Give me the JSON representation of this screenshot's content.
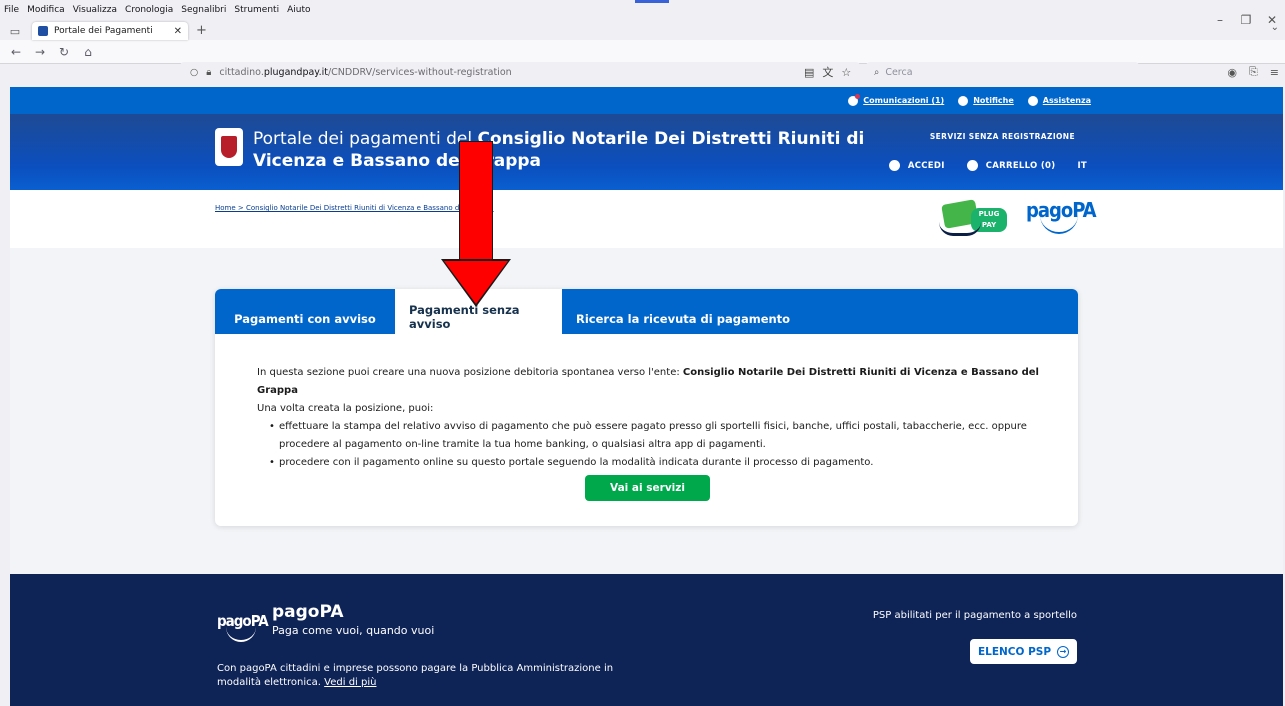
{
  "browser": {
    "menu": [
      "File",
      "Modifica",
      "Visualizza",
      "Cronologia",
      "Segnalibri",
      "Strumenti",
      "Aiuto"
    ],
    "tab_title": "Portale dei Pagamenti",
    "url_prefix": "cittadino.",
    "url_domain": "plugandpay.it",
    "url_path": "/CNDDRV/services-without-registration",
    "search_placeholder": "Cerca"
  },
  "topstrip": {
    "communications": "Comunicazioni (1)",
    "notifications": "Notifiche",
    "support": "Assistenza"
  },
  "header": {
    "title_prefix": "Portale dei pagamenti del ",
    "title_entity": "Consiglio Notarile Dei Distretti Riuniti di Vicenza e Bassano del Grappa",
    "services_label": "SERVIZI SENZA REGISTRAZIONE",
    "login": "ACCEDI",
    "cart": "CARRELLO (0)",
    "lang": "IT"
  },
  "breadcrumb": "Home > Consiglio Notarile Dei Distretti Riuniti di Vicenza e Bassano del Grappa",
  "brand": {
    "plug_text": "PLUG PAY",
    "pagopa_text": "pagoPA"
  },
  "tabs": {
    "with_notice": "Pagamenti con avviso",
    "without_notice": "Pagamenti senza avviso",
    "receipt": "Ricerca la ricevuta di pagamento"
  },
  "content": {
    "intro_prefix": "In questa sezione puoi creare una nuova posizione debitoria spontanea verso l'ente: ",
    "intro_entity": "Consiglio Notarile Dei Distretti Riuniti di Vicenza e Bassano del Grappa",
    "then": "Una volta creata la posizione, puoi:",
    "bullet1a": "effettuare la stampa del relativo avviso di pagamento che può essere pagato presso gli sportelli fisici, banche, uffici postali, tabaccherie, ecc. oppure",
    "bullet1b": "procedere al pagamento on-line tramite la tua home banking, o qualsiasi altra app di pagamenti.",
    "bullet2": "procedere con il pagamento online su questo portale seguendo la modalità indicata durante il processo di pagamento.",
    "cta": "Vai ai servizi"
  },
  "footer": {
    "logo": "pagoPA",
    "brand": "pagoPA",
    "tagline": "Paga come vuoi, quando vuoi",
    "desc": "Con pagoPA cittadini e imprese possono pagare la Pubblica Amministrazione in modalità elettronica.",
    "more": "Vedi di più",
    "psp_label": "PSP abilitati per il pagamento a sportello",
    "psp_button": "ELENCO PSP"
  },
  "colors": {
    "primary": "#0066cc",
    "header": "#1e4a94",
    "cta": "#00a84c",
    "footer": "#0e2356",
    "annotation_arrow": "#ff0000"
  }
}
